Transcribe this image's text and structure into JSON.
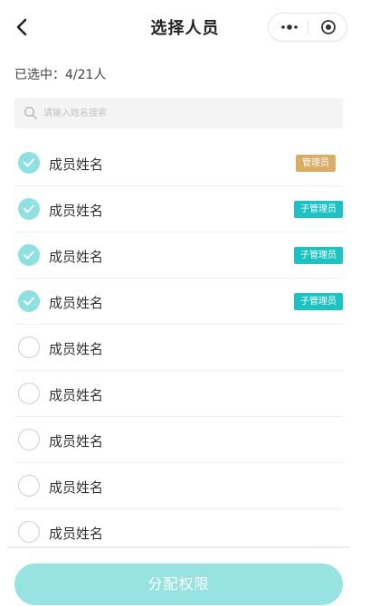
{
  "nav": {
    "title": "选择人员"
  },
  "summary": {
    "label": "已选中：4/21人"
  },
  "search": {
    "placeholder": "请输入姓名搜索"
  },
  "members": [
    {
      "name": "成员姓名",
      "checked": true,
      "badge": "管理员",
      "badge_type": "admin"
    },
    {
      "name": "成员姓名",
      "checked": true,
      "badge": "子管理员",
      "badge_type": "subadmin"
    },
    {
      "name": "成员姓名",
      "checked": true,
      "badge": "子管理员",
      "badge_type": "subadmin"
    },
    {
      "name": "成员姓名",
      "checked": true,
      "badge": "子管理员",
      "badge_type": "subadmin"
    },
    {
      "name": "成员姓名",
      "checked": false,
      "badge": "",
      "badge_type": ""
    },
    {
      "name": "成员姓名",
      "checked": false,
      "badge": "",
      "badge_type": ""
    },
    {
      "name": "成员姓名",
      "checked": false,
      "badge": "",
      "badge_type": ""
    },
    {
      "name": "成员姓名",
      "checked": false,
      "badge": "",
      "badge_type": ""
    },
    {
      "name": "成员姓名",
      "checked": false,
      "badge": "",
      "badge_type": ""
    }
  ],
  "footer": {
    "submit_label": "分配权限"
  },
  "colors": {
    "accent": "#1dc2c2",
    "check_on": "#8fe0e0",
    "admin_badge": "#d9ad63",
    "submit_bg": "#96e3e1"
  },
  "icons": {
    "back": "chevron-left-icon",
    "more": "more-dots-icon",
    "close": "target-close-icon",
    "search": "search-icon",
    "check": "check-icon"
  }
}
